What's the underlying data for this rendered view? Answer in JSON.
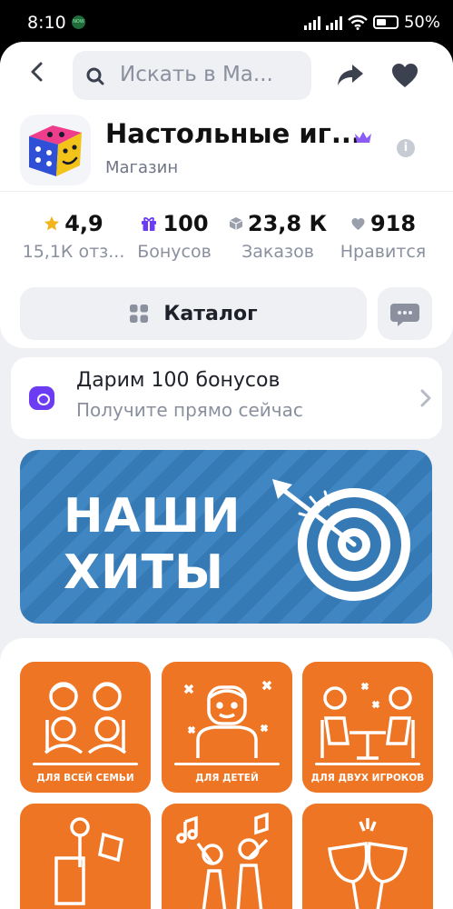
{
  "status_bar": {
    "time": "8:10",
    "app_badge": "NOW",
    "battery": "50%"
  },
  "header": {
    "search_placeholder": "Искать в Ма..."
  },
  "shop": {
    "name": "Настольные иг...",
    "subtitle": "Магазин"
  },
  "stats": [
    {
      "value": "4,9",
      "label": "15,1К отз...",
      "icon": "star-icon",
      "color": "#f3b419"
    },
    {
      "value": "100",
      "label": "Бонусов",
      "icon": "gift-icon",
      "color": "#6c3cf4"
    },
    {
      "value": "23,8 К",
      "label": "Заказов",
      "icon": "box-icon",
      "color": "#9aa0ab"
    },
    {
      "value": "918",
      "label": "Нравится",
      "icon": "heart-icon",
      "color": "#9aa0ab"
    }
  ],
  "catalog": {
    "label": "Каталог"
  },
  "bonus": {
    "title": "Дарим 100 бонусов",
    "subtitle": "Получите прямо сейчас"
  },
  "banner": {
    "line1": "НАШИ",
    "line2": "ХИТЫ"
  },
  "categories": [
    {
      "label": "ДЛЯ ВСЕЙ СЕМЬИ"
    },
    {
      "label": "ДЛЯ ДЕТЕЙ"
    },
    {
      "label": "ДЛЯ ДВУХ ИГРОКОВ"
    },
    {
      "label": ""
    },
    {
      "label": ""
    },
    {
      "label": ""
    }
  ],
  "colors": {
    "accent": "#6c3cf4",
    "tile": "#ee7523",
    "banner": "#3579b5",
    "background": "#eef0f4"
  }
}
